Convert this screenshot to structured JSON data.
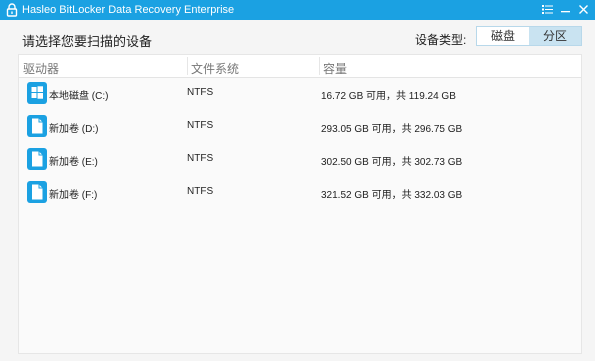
{
  "window": {
    "title": "Hasleo BitLocker Data Recovery Enterprise",
    "controls": [
      "menu-icon",
      "minimize-icon",
      "close-icon"
    ]
  },
  "heading": "请选择您要扫描的设备",
  "device_type": {
    "label": "设备类型:",
    "options": [
      "磁盘",
      "分区"
    ],
    "selected": "分区"
  },
  "table": {
    "headers": {
      "drive": "驱动器",
      "fs": "文件系统",
      "capacity": "容量"
    },
    "rows": [
      {
        "icon": "windows-drive-icon",
        "drive": "本地磁盘 (C:)",
        "fs": "NTFS",
        "capacity": "16.72 GB 可用，共 119.24 GB"
      },
      {
        "icon": "volume-icon",
        "drive": "新加卷 (D:)",
        "fs": "NTFS",
        "capacity": "293.05 GB 可用，共 296.75 GB"
      },
      {
        "icon": "volume-icon",
        "drive": "新加卷 (E:)",
        "fs": "NTFS",
        "capacity": "302.50 GB 可用，共 302.73 GB"
      },
      {
        "icon": "volume-icon",
        "drive": "新加卷 (F:)",
        "fs": "NTFS",
        "capacity": "321.52 GB 可用，共 332.03 GB"
      }
    ]
  },
  "colors": {
    "accent": "#1ba1e2",
    "selected_tab": "#c9e3f1"
  }
}
